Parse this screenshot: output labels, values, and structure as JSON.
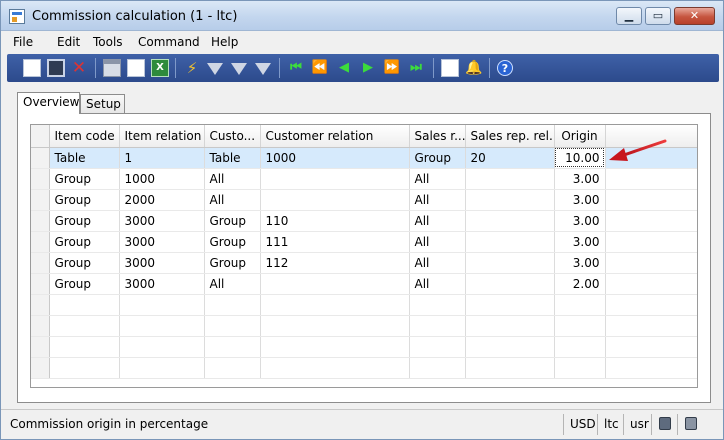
{
  "window": {
    "title": "Commission calculation (1 - ltc)",
    "caption": {
      "minimize": "▁",
      "maximize": "▭",
      "close": "✕"
    }
  },
  "menu": [
    "File",
    "Edit",
    "Tools",
    "Command",
    "Help"
  ],
  "toolbar_icons": [
    "new-icon",
    "save-icon",
    "delete-icon",
    "print-icon",
    "print-preview-icon",
    "export-excel-icon",
    "filter-by-selection-icon",
    "filter-by-grid-icon",
    "advanced-filter-icon",
    "remove-filter-icon",
    "first-record-icon",
    "previous-page-icon",
    "previous-record-icon",
    "next-record-icon",
    "next-page-icon",
    "last-record-icon",
    "document-handling-icon",
    "alert-icon",
    "help-icon"
  ],
  "tabs": [
    "Overview",
    "Setup"
  ],
  "grid": {
    "columns": [
      "Item code",
      "Item relation",
      "Custo...",
      "Customer relation",
      "Sales r...",
      "Sales rep. rel...",
      "Origin"
    ],
    "rows": [
      [
        "Table",
        "1",
        "Table",
        "1000",
        "Group",
        "20",
        "10.00"
      ],
      [
        "Group",
        "1000",
        "All",
        "",
        "All",
        "",
        "3.00"
      ],
      [
        "Group",
        "2000",
        "All",
        "",
        "All",
        "",
        "3.00"
      ],
      [
        "Group",
        "3000",
        "Group",
        "110",
        "All",
        "",
        "3.00"
      ],
      [
        "Group",
        "3000",
        "Group",
        "111",
        "All",
        "",
        "3.00"
      ],
      [
        "Group",
        "3000",
        "Group",
        "112",
        "All",
        "",
        "3.00"
      ],
      [
        "Group",
        "3000",
        "All",
        "",
        "All",
        "",
        "2.00"
      ]
    ],
    "selected_row": 0
  },
  "status": {
    "text": "Commission origin in percentage",
    "currency": "USD",
    "company": "ltc",
    "layer": "usr"
  },
  "colors": {
    "toolbar": "#2f4f94",
    "selected_row": "#d6eafc",
    "annotation_arrow": "#d9252a"
  }
}
